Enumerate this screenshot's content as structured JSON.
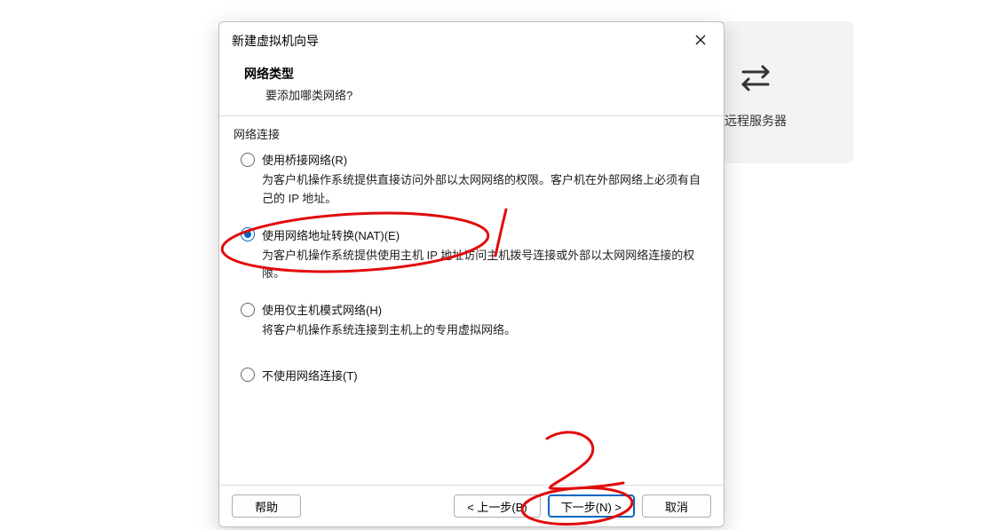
{
  "background": {
    "label": "远程服务器"
  },
  "dialog": {
    "title": "新建虚拟机向导",
    "header": {
      "title": "网络类型",
      "subtitle": "要添加哪类网络?"
    },
    "fieldset_label": "网络连接",
    "options": [
      {
        "label": "使用桥接网络(R)",
        "desc": "为客户机操作系统提供直接访问外部以太网网络的权限。客户机在外部网络上必须有自己的 IP 地址。",
        "selected": false
      },
      {
        "label": "使用网络地址转换(NAT)(E)",
        "desc": "为客户机操作系统提供使用主机 IP 地址访问主机拨号连接或外部以太网网络连接的权限。",
        "selected": true
      },
      {
        "label": "使用仅主机模式网络(H)",
        "desc": "将客户机操作系统连接到主机上的专用虚拟网络。",
        "selected": false
      },
      {
        "label": "不使用网络连接(T)",
        "desc": "",
        "selected": false
      }
    ],
    "buttons": {
      "help": "帮助",
      "back": "< 上一步(B)",
      "next": "下一步(N) >",
      "cancel": "取消"
    }
  },
  "annotation": {
    "mark1": "1",
    "mark2": "2",
    "color": "#e20b0b"
  }
}
